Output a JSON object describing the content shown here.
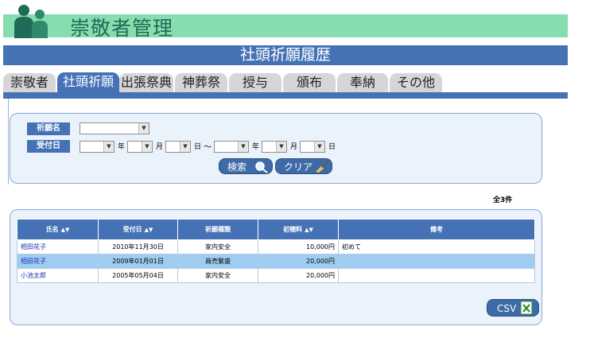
{
  "header": {
    "app_title": "崇敬者管理"
  },
  "page": {
    "title": "社頭祈願履歴"
  },
  "tabs": [
    {
      "label": "崇敬者",
      "active": false
    },
    {
      "label": "社頭祈願",
      "active": true
    },
    {
      "label": "出張祭典",
      "active": false
    },
    {
      "label": "神葬祭",
      "active": false
    },
    {
      "label": "授与",
      "active": false
    },
    {
      "label": "頒布",
      "active": false
    },
    {
      "label": "奉納",
      "active": false
    },
    {
      "label": "その他",
      "active": false
    }
  ],
  "search": {
    "prayer_name_label": "祈願名",
    "date_label": "受付日",
    "units": {
      "year": "年",
      "month": "月",
      "day": "日",
      "range": "～"
    },
    "search_button": "検索",
    "clear_button": "クリア"
  },
  "results": {
    "count_text": "全3件",
    "sort_symbol": "▲▼",
    "columns": [
      "氏名",
      "受付日",
      "祈願種類",
      "初穂料",
      "備考"
    ],
    "rows": [
      {
        "name": "相田花子",
        "date": "2010年11月30日",
        "type": "家内安全",
        "fee": "10,000円",
        "note": "初めて"
      },
      {
        "name": "相田花子",
        "date": "2009年01月01日",
        "type": "商売繁盛",
        "fee": "20,000円",
        "note": ""
      },
      {
        "name": "小池太郎",
        "date": "2005年05月04日",
        "type": "家内安全",
        "fee": "20,000円",
        "note": ""
      }
    ],
    "csv_button": "CSV"
  },
  "colors": {
    "header_green": "#86ddb0",
    "accent_blue": "#4472b5",
    "highlight_row": "#9fcdf2"
  }
}
